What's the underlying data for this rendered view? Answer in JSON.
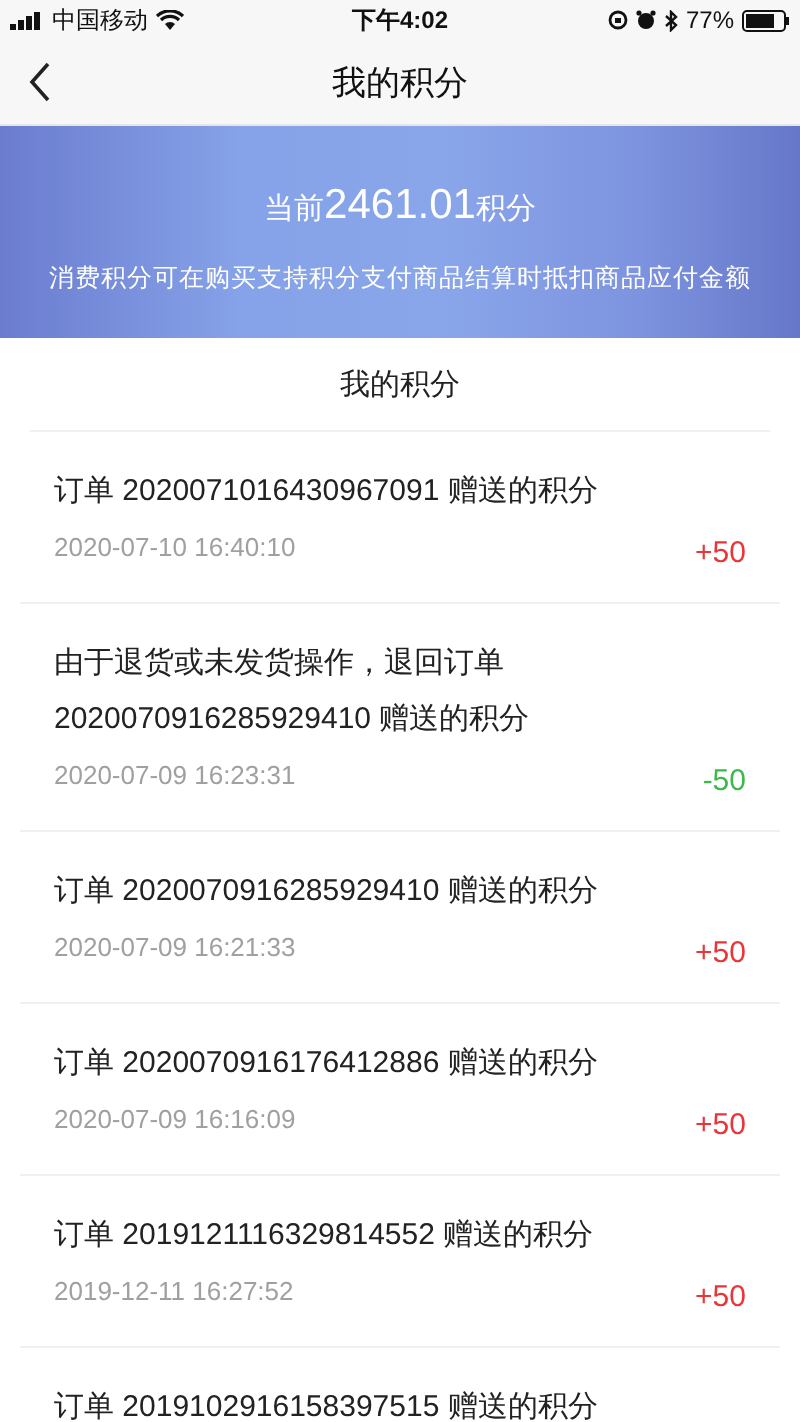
{
  "status_bar": {
    "carrier": "中国移动",
    "time": "下午4:02",
    "battery": "77%"
  },
  "nav": {
    "title": "我的积分"
  },
  "banner": {
    "prefix": "当前",
    "points": "2461.01",
    "suffix": "积分",
    "note": "消费积分可在购买支持积分支付商品结算时抵扣商品应付金额"
  },
  "section_title": "我的积分",
  "records": [
    {
      "description": "订单 2020071016430967091 赠送的积分",
      "time": "2020-07-10 16:40:10",
      "amount": "+50",
      "color": "#e8353a"
    },
    {
      "description": "由于退货或未发货操作，退回订单 2020070916285929410 赠送的积分",
      "time": "2020-07-09 16:23:31",
      "amount": "-50",
      "color": "#3db84a"
    },
    {
      "description": "订单 2020070916285929410 赠送的积分",
      "time": "2020-07-09 16:21:33",
      "amount": "+50",
      "color": "#e8353a"
    },
    {
      "description": "订单 2020070916176412886 赠送的积分",
      "time": "2020-07-09 16:16:09",
      "amount": "+50",
      "color": "#e8353a"
    },
    {
      "description": "订单 2019121116329814552 赠送的积分",
      "time": "2019-12-11 16:27:52",
      "amount": "+50",
      "color": "#e8353a"
    },
    {
      "description": "订单 2019102916158397515 赠送的积分"
    }
  ]
}
